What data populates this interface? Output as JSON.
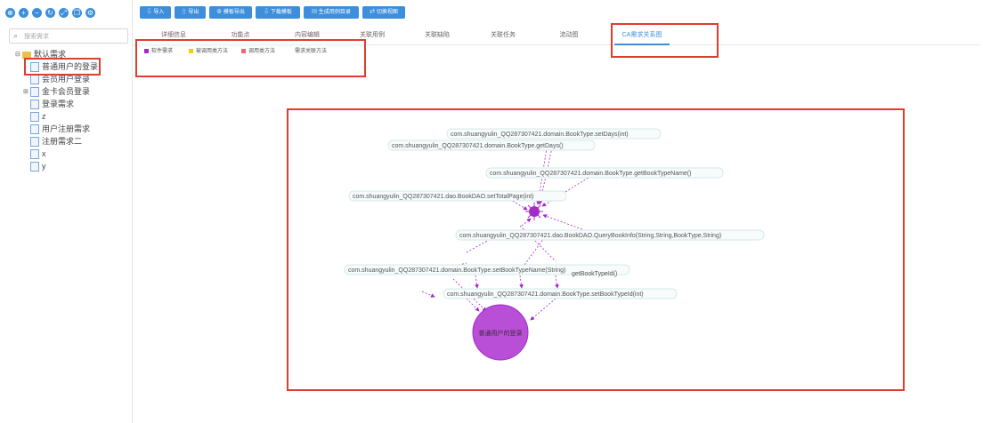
{
  "toolbar_left": {
    "icons": [
      "add-circle-icon",
      "plus-icon",
      "minus-icon",
      "refresh-icon",
      "expand-icon",
      "copy-icon",
      "settings-icon"
    ]
  },
  "search": {
    "placeholder": "搜索需求"
  },
  "tree": {
    "root": "默认需求",
    "items": [
      {
        "label": "普通用户的登录",
        "selected": true
      },
      {
        "label": "会员用户登录"
      },
      {
        "label": "金卡会员登录",
        "collapsed": true
      },
      {
        "label": "登录需求"
      },
      {
        "label": "z"
      },
      {
        "label": "用户注册需求"
      },
      {
        "label": "注册需求二"
      },
      {
        "label": "x"
      },
      {
        "label": "y"
      }
    ]
  },
  "toolbar": {
    "import": "导入",
    "export": "导出",
    "template_import": "模板导出",
    "download_template": "下载模板",
    "generate_case": "生成用例目录",
    "switch_view": "切换视图"
  },
  "tabs": [
    "详细信息",
    "功能点",
    "内容编辑",
    "关联用例",
    "关联缺陷",
    "关联任务",
    "流动图",
    "CA需求关系图"
  ],
  "active_tab": 7,
  "legend": [
    {
      "label": "软件需求",
      "color": "#a52bc9"
    },
    {
      "label": "被调用类方法",
      "color": "#f4d20a"
    },
    {
      "label": "调用类方法",
      "color": "#f0676b"
    },
    {
      "label": "需求关联方法",
      "color": "#ffffff"
    }
  ],
  "graph": {
    "hub_color": "#a52bc9",
    "nodes": [
      {
        "id": "n1",
        "label": "com.shuangyulin_QQ287307421.domain.BookType.setDays(int)"
      },
      {
        "id": "n2",
        "label": "com.shuangyulin_QQ287307421.domain.BookType.getDays()"
      },
      {
        "id": "n3",
        "label": "com.shuangyulin_QQ287307421.domain.BookType.getBookTypeName()"
      },
      {
        "id": "n4",
        "label": "com.shuangyulin_QQ287307421.dao.BookDAO.setTotalPage(int)"
      },
      {
        "id": "n5",
        "label": "com.shuangyulin_QQ287307421.dao.BookDAO.QueryBookInfo(String,String,BookType,String)"
      },
      {
        "id": "n6",
        "label": "com.shuangyulin_QQ287307421.domain.BookType.setBookTypeName(String)"
      },
      {
        "id": "n6b",
        "label": "getBookTypeId()"
      },
      {
        "id": "n7",
        "label": "com.shuangyulin_QQ287307421.domain.BookType.setBookTypeId(int)"
      }
    ],
    "requirement_node": "普通用户的登录"
  }
}
